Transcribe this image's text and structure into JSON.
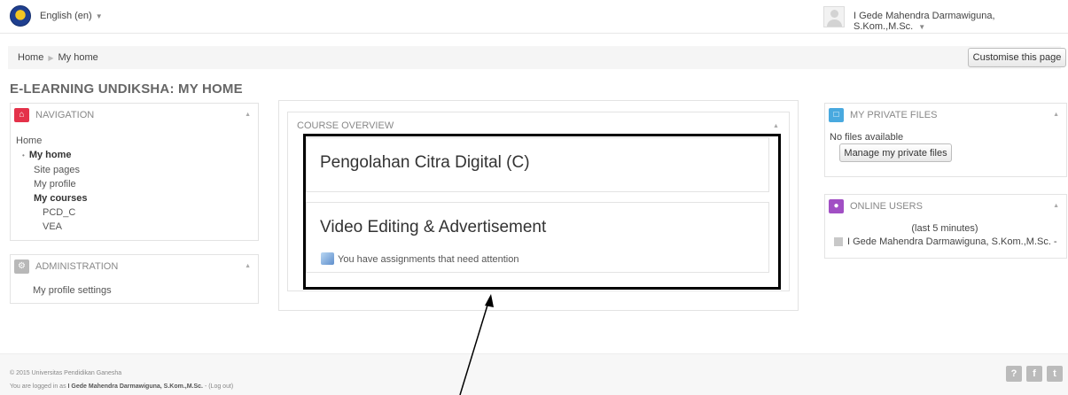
{
  "header": {
    "language": "English (en)",
    "user_name": "I Gede Mahendra Darmawiguna, S.Kom.,M.Sc."
  },
  "breadcrumb": {
    "home": "Home",
    "current": "My home",
    "separator": "▶"
  },
  "actions": {
    "customise": "Customise this page"
  },
  "page": {
    "title": "E-LEARNING UNDIKSHA: MY HOME"
  },
  "navigation": {
    "title": "NAVIGATION",
    "items": {
      "home": "Home",
      "my_home": "My home",
      "site_pages": "Site pages",
      "my_profile": "My profile",
      "my_courses": "My courses",
      "course_1": "PCD_C",
      "course_2": "VEA"
    }
  },
  "administration": {
    "title": "ADMINISTRATION",
    "item": "My profile settings"
  },
  "course_overview": {
    "title": "COURSE OVERVIEW",
    "courses": [
      {
        "name": "Pengolahan Citra Digital (C)"
      },
      {
        "name": "Video Editing & Advertisement",
        "notice": "You have assignments that need attention"
      }
    ]
  },
  "private_files": {
    "title": "MY PRIVATE FILES",
    "status": "No files available",
    "button": "Manage my private files"
  },
  "online_users": {
    "title": "ONLINE USERS",
    "range": "(last 5 minutes)",
    "user": "I Gede Mahendra Darmawiguna, S.Kom.,M.Sc. -"
  },
  "footer": {
    "copyright": "© 2015 Universitas Pendidikan Ganesha",
    "logged_in_prefix": "You are logged in as ",
    "logged_in_user": "I Gede Mahendra Darmawiguna, S.Kom.,M.Sc.",
    "logout": " - (Log out)"
  },
  "colors": {
    "navigation_icon": "#e4324a",
    "administration_icon": "#b8b8b8",
    "files_icon": "#49a9df",
    "online_icon": "#a14fc4",
    "highlight": "#000000",
    "footer_icons": "#bbbbbb"
  },
  "icons": {
    "footer": [
      "help-icon",
      "facebook-icon",
      "twitter-icon"
    ]
  }
}
